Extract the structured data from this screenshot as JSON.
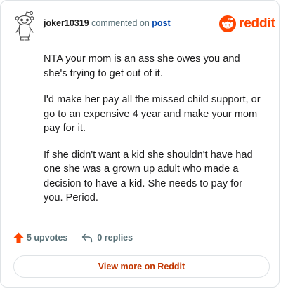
{
  "comment": {
    "author": "joker10319",
    "action_text": "commented on",
    "post_link": "post",
    "paragraphs": [
      "NTA your mom is an ass she owes you and she's trying to get out of it.",
      "I'd make her pay all the missed child support, or go to an expensive 4 year and make your mom pay for it.",
      "If she didn't want a kid she shouldn't have had one she was a grown up adult who made a decision to have a kid. She needs to pay for you. Period."
    ],
    "upvotes_label": "5 upvotes",
    "replies_label": "0 replies"
  },
  "brand": {
    "wordmark": "reddit",
    "color": "#ff4500",
    "icon": "reddit-snoo-icon"
  },
  "cta": {
    "label": "View more on Reddit",
    "color": "#c23600"
  },
  "colors": {
    "upvote": "#ff4500",
    "link": "#0045ac",
    "muted": "#576f76"
  }
}
